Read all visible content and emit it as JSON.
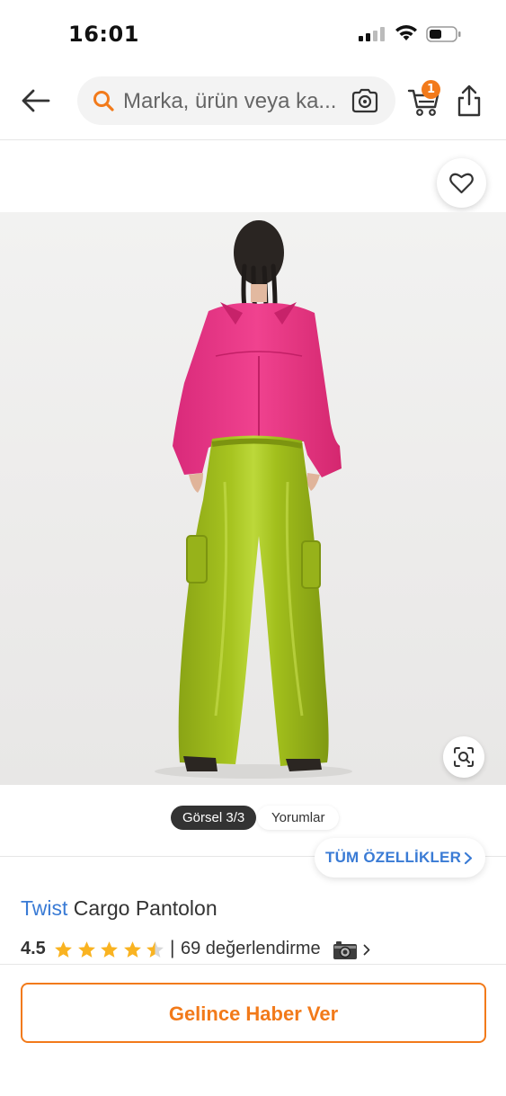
{
  "status_bar": {
    "time": "16:01"
  },
  "header": {
    "search_placeholder": "Marka, ürün veya ka...",
    "cart_count": "1"
  },
  "colors": {
    "accent": "#f27a1a",
    "link": "#3a7bd5",
    "star": "#f9b321"
  },
  "icons": [
    "back-arrow-icon",
    "search-icon",
    "camera-icon",
    "cart-icon",
    "share-icon",
    "heart-icon",
    "visual-search-icon",
    "chevron-right-icon",
    "star-icon",
    "photo-camera-icon"
  ],
  "gallery": {
    "image_tab_label": "Görsel 3/3",
    "reviews_tab_label": "Yorumlar",
    "all_features_label": "TÜM ÖZELLİKLER"
  },
  "product": {
    "brand": "Twist",
    "name": "Cargo Pantolon",
    "rating": "4.5",
    "stars": 4.5,
    "rating_separator": "|",
    "rating_count_text": "69 değerlendirme"
  },
  "cta": {
    "notify_label": "Gelince Haber Ver"
  }
}
